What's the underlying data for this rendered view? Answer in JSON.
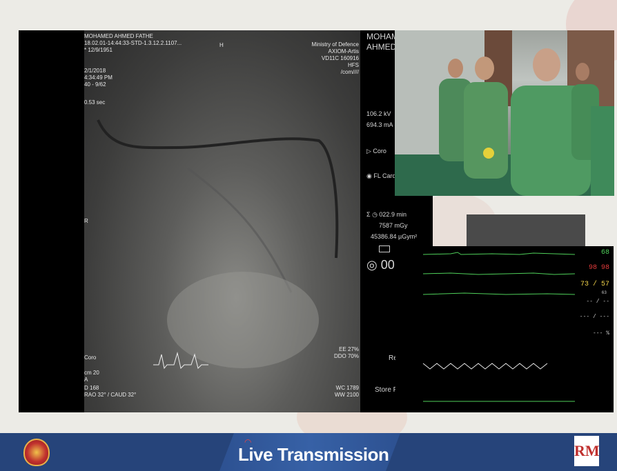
{
  "fluoro": {
    "patient_name": "MOHAMED AHMED FATHE",
    "study_line": "18.02.01-14:44:33-STD-1.3.12.2.1107...",
    "study_id": "* 12/9/1951",
    "date": "2/1/2018",
    "time": "4:34:49 PM",
    "frame": "40 - 9/62",
    "duration": "0.53 sec",
    "marker_h": "H",
    "marker_r": "R",
    "institution": "Ministry of Defence",
    "system": "AXIOM-Artis",
    "version": "VD11C 160916",
    "hfs": "HFS",
    "com": "/com////",
    "mode": "Coro",
    "cm": "cm 20",
    "a": "A",
    "d": "D 168",
    "angle": "RAO 32° / CAUD 32°",
    "ee": "EE 27%",
    "ddo": "DDO 70%",
    "wc": "WC 1789",
    "ww": "WW 2100"
  },
  "side": {
    "name1": "MOHAM",
    "name2": "AHMED",
    "kv": "106.2 kV",
    "ma": "694.3 mA",
    "coro": "Coro",
    "fl": "FL Card",
    "time_min": "022.9 min",
    "mgy": "7587 mGy",
    "dap": "45386.84 µGym²",
    "counter": "00",
    "re": "Re",
    "store": "Store F"
  },
  "monitor": {
    "hr": "68",
    "red_vals": "98   98",
    "bp": "73 / 57",
    "bp_sub": "63",
    "dash1": "-- / --",
    "dash2": "--- / ---",
    "dash3": "--- %"
  },
  "bottom": {
    "title": "Live Transmission",
    "logo_right": "RM"
  }
}
